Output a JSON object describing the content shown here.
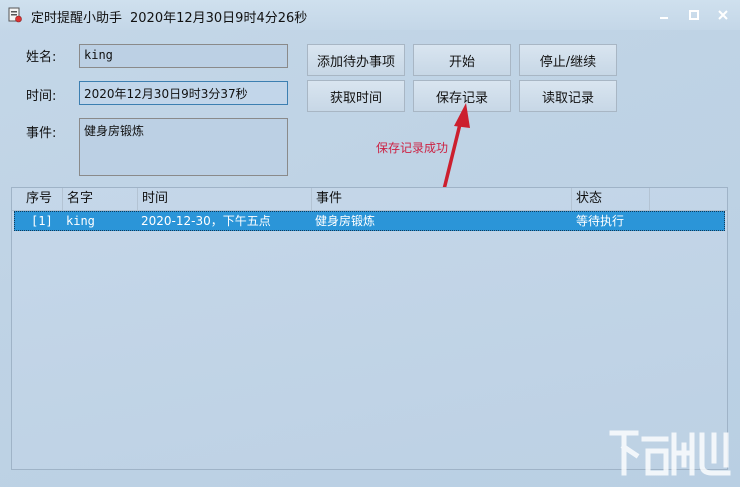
{
  "window": {
    "title": "定时提醒小助手",
    "subtitle": "2020年12月30日9时4分26秒"
  },
  "form": {
    "name_label": "姓名:",
    "name_value": "king",
    "time_label": "时间:",
    "time_value": "2020年12月30日9时3分37秒",
    "event_label": "事件:",
    "event_value": "健身房锻炼"
  },
  "buttons": {
    "add_todo": "添加待办事项",
    "start": "开始",
    "stop_resume": "停止/继续",
    "get_time": "获取时间",
    "save_record": "保存记录",
    "read_record": "读取记录"
  },
  "status_message": "保存记录成功",
  "table": {
    "headers": [
      "序号",
      "名字",
      "时间",
      "事件",
      "状态"
    ],
    "rows": [
      {
        "index": "[1]",
        "name": "king",
        "time": "2020-12-30，下午五点",
        "event": "健身房锻炼",
        "status": "等待执行"
      }
    ]
  },
  "colors": {
    "selected_row": "#2b95d8",
    "status_message": "#cc2244",
    "arrow": "#cc1f2e"
  },
  "icons": [
    "app-icon",
    "minimize-icon",
    "maximize-icon",
    "close-icon",
    "watermark-logo"
  ]
}
